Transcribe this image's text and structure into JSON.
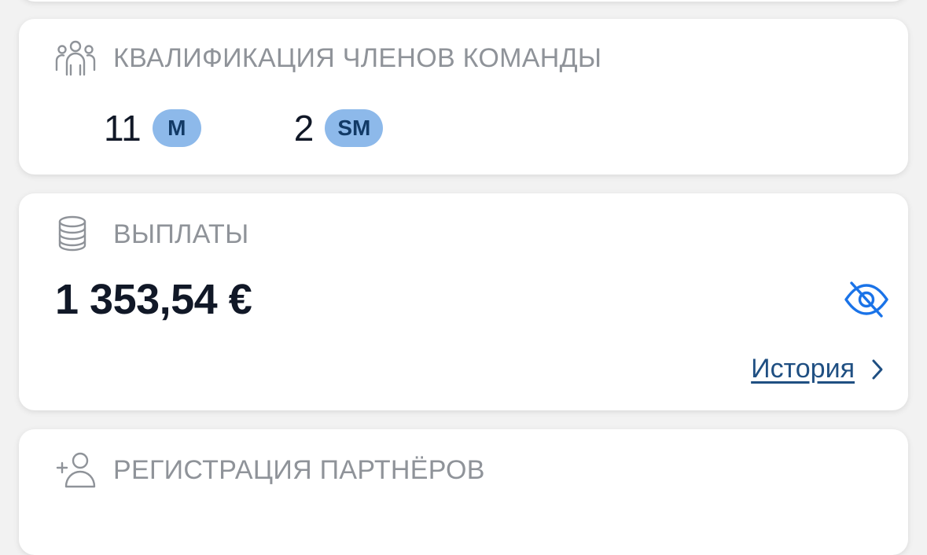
{
  "qualification_card": {
    "title": "КВАЛИФИКАЦИЯ ЧЛЕНОВ КОМАНДЫ",
    "icon": "team-icon",
    "items": [
      {
        "count": "11",
        "badge": "M"
      },
      {
        "count": "2",
        "badge": "SM"
      }
    ]
  },
  "payouts_card": {
    "title": "ВЫПЛАТЫ",
    "icon": "coins-stack-icon",
    "amount": "1 353,54 €",
    "visibility_icon": "eye-off-icon",
    "history_label": "История",
    "history_icon": "chevron-right-icon"
  },
  "registration_card": {
    "title": "РЕГИСТРАЦИЯ ПАРТНЁРОВ",
    "icon": "add-user-icon"
  },
  "colors": {
    "background": "#f2f2f2",
    "card": "#ffffff",
    "header_text": "#8f9399",
    "primary_text": "#111827",
    "badge_bg": "#8db9ea",
    "badge_text": "#123a66",
    "accent_blue": "#1a73e8",
    "link": "#1f4f82"
  }
}
